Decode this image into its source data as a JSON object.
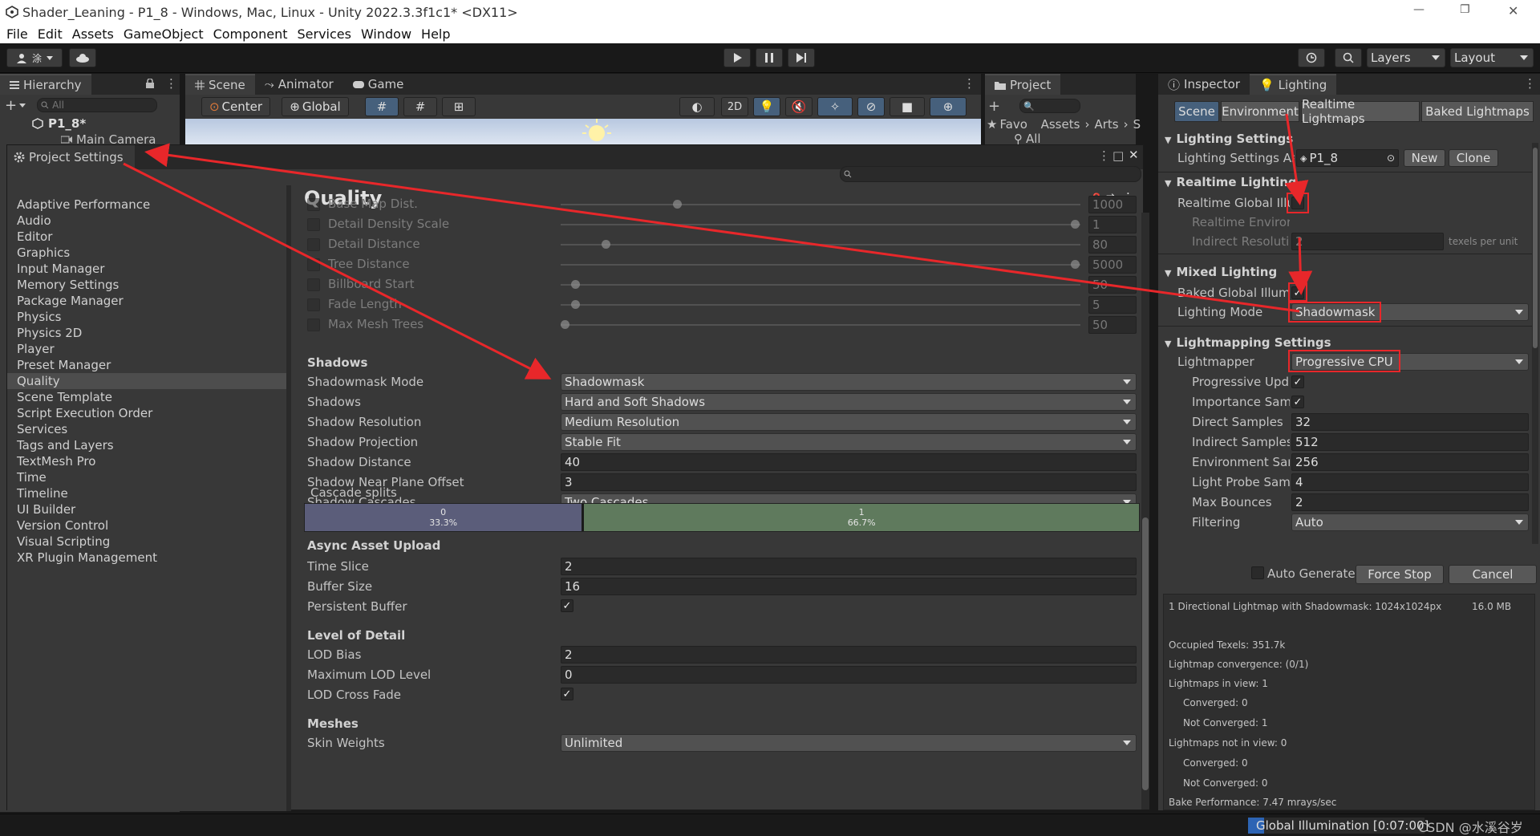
{
  "window": {
    "title": "Shader_Leaning - P1_8 - Windows, Mac, Linux - Unity 2022.3.3f1c1* <DX11>",
    "minimize_glyph": "—",
    "restore_glyph": "❐",
    "close_glyph": "✕"
  },
  "menu": [
    "File",
    "Edit",
    "Assets",
    "GameObject",
    "Component",
    "Services",
    "Window",
    "Help"
  ],
  "toolbar": {
    "account_label": "涂",
    "layers_label": "Layers",
    "layout_label": "Layout"
  },
  "hierarchy": {
    "tab": "Hierarchy",
    "search_placeholder": "All",
    "scene_name": "P1_8*",
    "items": [
      "Main Camera"
    ]
  },
  "scene_tabs": [
    "Scene",
    "Animator",
    "Game"
  ],
  "scene_toolbar": {
    "pivot": "Center",
    "space": "Global",
    "mode_2d": "2D"
  },
  "project_panel": {
    "tab": "Project",
    "favorites": "Favo",
    "all": "All",
    "breadcrumb": [
      "Assets",
      "Arts",
      "S"
    ]
  },
  "project_settings": {
    "title": "Project Settings",
    "categories": [
      "Adaptive Performance",
      "Audio",
      "Editor",
      "Graphics",
      "Input Manager",
      "Memory Settings",
      "Package Manager",
      "Physics",
      "Physics 2D",
      "Player",
      "Preset Manager",
      "Quality",
      "Scene Template",
      "Script Execution Order",
      "Services",
      "Tags and Layers",
      "TextMesh Pro",
      "Time",
      "Timeline",
      "UI Builder",
      "Version Control",
      "Visual Scripting",
      "XR Plugin Management"
    ],
    "selected": "Quality",
    "heading": "Quality",
    "terrain_rows": [
      {
        "label": "Base Map Dist.",
        "value": "1000",
        "fraction": 0.22
      },
      {
        "label": "Detail Density Scale",
        "value": "1",
        "fraction": 1.0
      },
      {
        "label": "Detail Distance",
        "value": "80",
        "fraction": 0.08
      },
      {
        "label": "Tree Distance",
        "value": "5000",
        "fraction": 1.0
      },
      {
        "label": "Billboard Start",
        "value": "50",
        "fraction": 0.02
      },
      {
        "label": "Fade Length",
        "value": "5",
        "fraction": 0.02
      },
      {
        "label": "Max Mesh Trees",
        "value": "50",
        "fraction": 0.0
      }
    ],
    "shadows": {
      "heading": "Shadows",
      "rows": [
        {
          "label": "Shadowmask Mode",
          "value": "Shadowmask",
          "kind": "dropdown"
        },
        {
          "label": "Shadows",
          "value": "Hard and Soft Shadows",
          "kind": "dropdown"
        },
        {
          "label": "Shadow Resolution",
          "value": "Medium Resolution",
          "kind": "dropdown"
        },
        {
          "label": "Shadow Projection",
          "value": "Stable Fit",
          "kind": "dropdown"
        },
        {
          "label": "Shadow Distance",
          "value": "40",
          "kind": "field"
        },
        {
          "label": "Shadow Near Plane Offset",
          "value": "3",
          "kind": "field"
        },
        {
          "label": "Shadow Cascades",
          "value": "Two Cascades",
          "kind": "dropdown"
        }
      ],
      "cascade_label": "Cascade splits",
      "cascades": [
        {
          "index": "0",
          "percent": "33.3%",
          "fraction": 0.333,
          "color": "#5b5d7a"
        },
        {
          "index": "1",
          "percent": "66.7%",
          "fraction": 0.667,
          "color": "#5f7a5d"
        }
      ]
    },
    "async": {
      "heading": "Async Asset Upload",
      "time_slice_label": "Time Slice",
      "time_slice": "2",
      "buffer_size_label": "Buffer Size",
      "buffer_size": "16",
      "persistent_label": "Persistent Buffer",
      "persistent": true
    },
    "lod": {
      "heading": "Level of Detail",
      "bias_label": "LOD Bias",
      "bias": "2",
      "max_label": "Maximum LOD Level",
      "max": "0",
      "crossfade_label": "LOD Cross Fade",
      "crossfade": true
    },
    "meshes": {
      "heading": "Meshes",
      "skin_label": "Skin Weights",
      "skin": "Unlimited"
    }
  },
  "inspector_tabs": [
    "Inspector",
    "Lighting"
  ],
  "lighting": {
    "subtabs": [
      "Scene",
      "Environment",
      "Realtime Lightmaps",
      "Baked Lightmaps"
    ],
    "settings_heading": "Lighting Settings",
    "settings_asset_label": "Lighting Settings As",
    "settings_asset": "P1_8",
    "new_btn": "New",
    "clone_btn": "Clone",
    "realtime_heading": "Realtime Lighting",
    "realtime_gi_label": "Realtime Global Illu",
    "realtime_env_label": "Realtime Enviror",
    "indirect_res_label": "Indirect Resoluti",
    "indirect_res": "2",
    "indirect_res_unit": "texels per unit",
    "mixed_heading": "Mixed Lighting",
    "baked_gi_label": "Baked Global Illumi",
    "lighting_mode_label": "Lighting Mode",
    "lighting_mode": "Shadowmask",
    "lightmapping_heading": "Lightmapping Settings",
    "lightmapper_label": "Lightmapper",
    "lightmapper": "Progressive CPU",
    "prog_updates_label": "Progressive Upd",
    "importance_label": "Importance Sam",
    "direct_label": "Direct Samples",
    "direct": "32",
    "indirect_label": "Indirect Samples",
    "indirect": "512",
    "env_label": "Environment Sar",
    "env": "256",
    "probe_label": "Light Probe Sam",
    "probe": "4",
    "bounces_label": "Max Bounces",
    "bounces": "2",
    "filtering_label": "Filtering",
    "filtering": "Auto",
    "auto_generate": "Auto Generate",
    "force_stop": "Force Stop",
    "cancel": "Cancel",
    "stats": {
      "line1": "1 Directional Lightmap with Shadowmask: 1024x1024px",
      "size": "16.0 MB",
      "occupied": "Occupied Texels: 351.7k",
      "convergence": "Lightmap convergence: (0/1)",
      "in_view": "Lightmaps in view: 1",
      "in_conv": "Converged: 0",
      "in_notconv": "Not Converged: 1",
      "not_in_view": "Lightmaps not in view: 0",
      "out_conv": "Converged: 0",
      "out_notconv": "Not Converged: 0",
      "bake_perf": "Bake Performance: 7.47 mrays/sec"
    }
  },
  "statusbar": {
    "gi": "Global Illumination [0:07:00]",
    "watermark": "CSDN @水溪谷岁"
  }
}
